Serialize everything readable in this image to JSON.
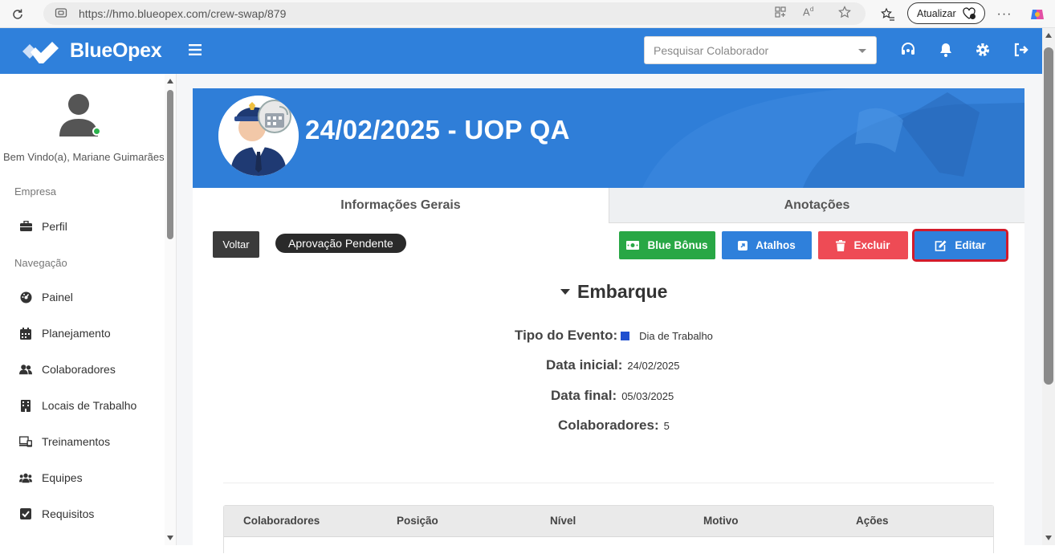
{
  "browser": {
    "url": "https://hmo.blueopex.com/crew-swap/879",
    "update_label": "Atualizar"
  },
  "header": {
    "brand": "BlueOpex",
    "search_placeholder": "Pesquisar Colaborador"
  },
  "sidebar": {
    "welcome": "Bem Vindo(a), Mariane Guimarães",
    "section_company": "Empresa",
    "section_nav": "Navegação",
    "items": [
      {
        "label": "Perfil",
        "icon": "briefcase-icon"
      },
      {
        "label": "Painel",
        "icon": "dashboard-icon"
      },
      {
        "label": "Planejamento",
        "icon": "calendar-icon"
      },
      {
        "label": "Colaboradores",
        "icon": "users-icon"
      },
      {
        "label": "Locais de Trabalho",
        "icon": "building-icon"
      },
      {
        "label": "Treinamentos",
        "icon": "training-icon"
      },
      {
        "label": "Equipes",
        "icon": "team-icon"
      },
      {
        "label": "Requisitos",
        "icon": "check-square-icon"
      }
    ]
  },
  "page": {
    "title": "24/02/2025 - UOP QA",
    "tabs": [
      {
        "label": "Informações Gerais"
      },
      {
        "label": "Anotações"
      }
    ],
    "back_label": "Voltar",
    "status": "Aprovação Pendente",
    "actions": {
      "bonus": "Blue Bônus",
      "shortcuts": "Atalhos",
      "delete": "Excluir",
      "edit": "Editar"
    },
    "section_title": "Embarque",
    "details": {
      "event_type_label": "Tipo do Evento:",
      "event_type_value": "Dia de Trabalho",
      "start_label": "Data inicial:",
      "start_value": "24/02/2025",
      "end_label": "Data final:",
      "end_value": "05/03/2025",
      "crew_label": "Colaboradores:",
      "crew_value": "5"
    },
    "table_headers": [
      "Colaboradores",
      "Posição",
      "Nível",
      "Motivo",
      "Ações"
    ]
  },
  "colors": {
    "brand_blue": "#2f80db",
    "success": "#28a745",
    "danger": "#ee4b55",
    "highlight": "#d21b2b"
  }
}
